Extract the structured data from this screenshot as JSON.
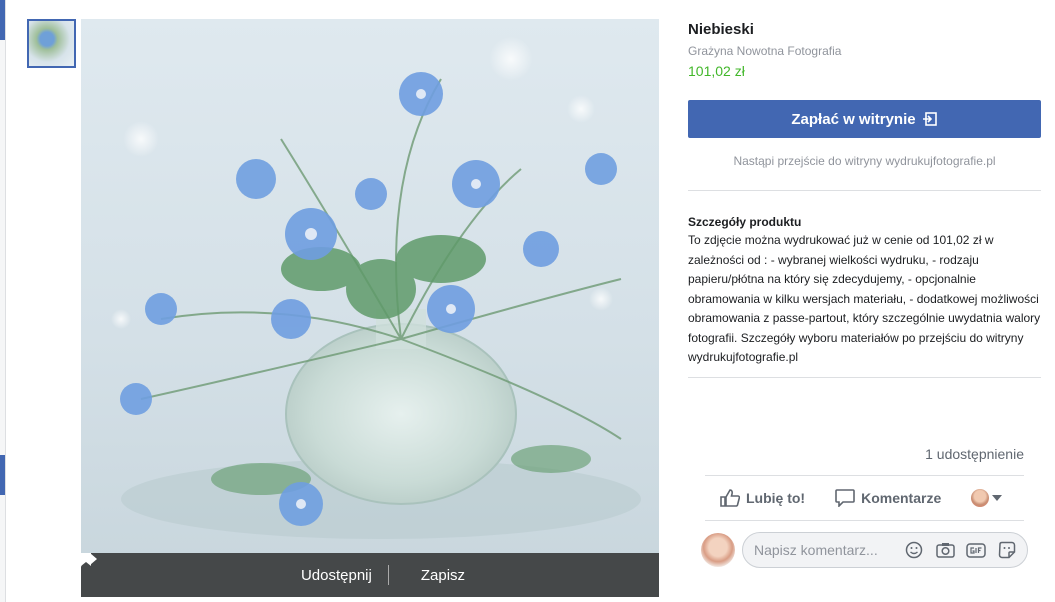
{
  "product": {
    "title": "Niebieski",
    "seller": "Grażyna Nowotna Fotografia",
    "price": "101,02 zł"
  },
  "checkout": {
    "button_label": "Zapłać w witrynie",
    "redirect_note": "Nastąpi przejście do witryny wydrukujfotografie.pl"
  },
  "details": {
    "heading": "Szczegóły produktu",
    "text": "To zdjęcie można wydrukować już w cenie od 101,02  zł w zależności od : - wybranej wielkości wydruku, - rodzaju papieru/płótna na który się zdecydujemy, - opcjonalnie obramowania w kilku wersjach materiału, - dodatkowej możliwości obramowania z passe-partout, który szczególnie uwydatnia walory fotografii. Szczegóły wyboru materiałów po przejściu do witryny wydrukujfotografie.pl"
  },
  "photo_bar": {
    "share_label": "Udostępnij",
    "save_label": "Zapisz"
  },
  "social": {
    "shares": "1 udostępnienie",
    "like_label": "Lubię to!",
    "comment_label": "Komentarze"
  },
  "composer": {
    "placeholder": "Napisz komentarz..."
  },
  "colors": {
    "brand_blue": "#4267b2",
    "price_green": "#42b72a",
    "muted": "#90949c"
  }
}
